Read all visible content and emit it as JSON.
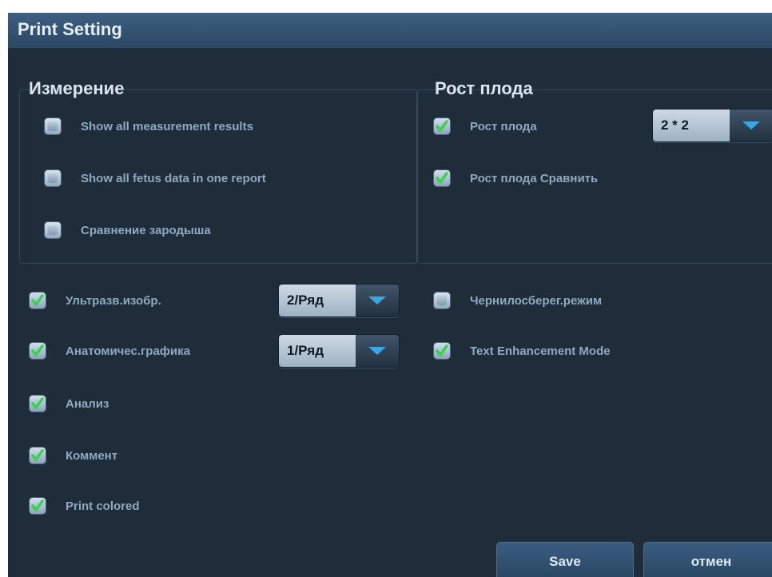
{
  "dialog": {
    "title": "Print Setting"
  },
  "measurement": {
    "title": "Измерение",
    "options": [
      {
        "label": "Show all measurement results",
        "checked": false
      },
      {
        "label": "Show all fetus data in one report",
        "checked": false
      },
      {
        "label": "Сравнение зародыша",
        "checked": false
      }
    ]
  },
  "fetal_growth": {
    "title": "Рост плода",
    "growth": {
      "label": "Рост плода",
      "checked": true,
      "layout_value": "2 * 2"
    },
    "compare": {
      "label": "Рост плода Сравнить",
      "checked": true
    }
  },
  "general": {
    "ultrasound": {
      "label": "Ультразв.изобр.",
      "checked": true,
      "value": "2/Ряд"
    },
    "anatomy": {
      "label": "Анатомичес.графика",
      "checked": true,
      "value": "1/Ряд"
    },
    "analysis": {
      "label": "Анализ",
      "checked": true
    },
    "comment": {
      "label": "Коммент",
      "checked": true
    },
    "print_colored": {
      "label": "Print colored",
      "checked": true
    },
    "ink_saver": {
      "label": "Чернилосберег.режим",
      "checked": false
    },
    "text_enhancement": {
      "label": "Text Enhancement Mode",
      "checked": true
    }
  },
  "buttons": {
    "save": "Save",
    "cancel": "отмен"
  },
  "colors": {
    "background": "#1f2d3a",
    "titlebar": "#2f4e6b",
    "label": "#8fa9c1",
    "check_green": "#39d24a",
    "arrow_blue": "#3aa6e3"
  }
}
